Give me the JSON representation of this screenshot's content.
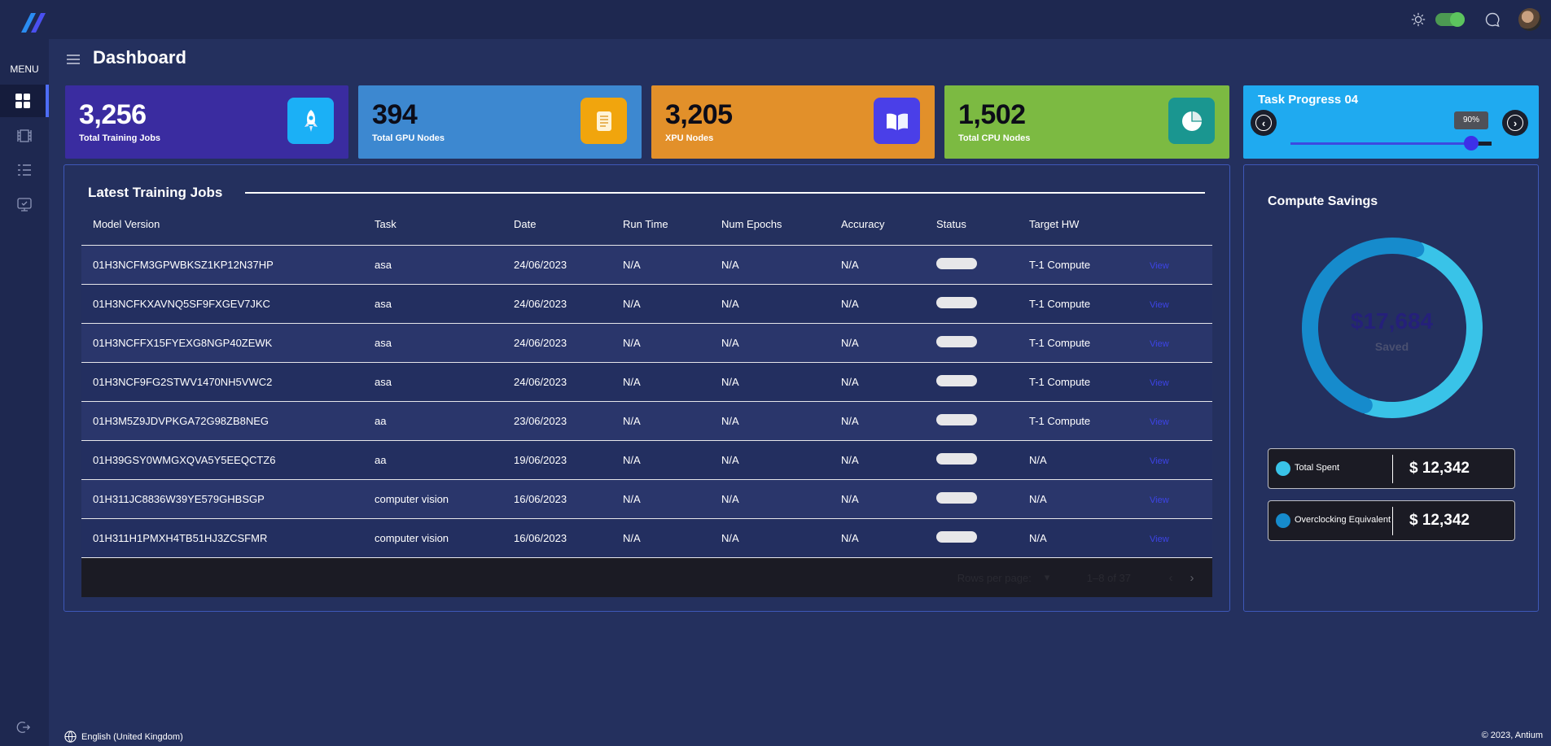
{
  "header": {
    "logo_icon": "brand-slashes-logo",
    "theme_icon": "sun-icon",
    "theme_toggle_on": true,
    "chat_icon": "chat-bubble-icon",
    "avatar_icon": "user-avatar"
  },
  "sidebar": {
    "menu_label": "MENU",
    "items": [
      {
        "icon": "grid-dashboard-icon",
        "active": true
      },
      {
        "icon": "film-strip-icon",
        "active": false
      },
      {
        "icon": "list-icon",
        "active": false
      },
      {
        "icon": "monitor-badge-icon",
        "active": false
      }
    ],
    "logout_icon": "logout-icon"
  },
  "page": {
    "title": "Dashboard"
  },
  "stats": [
    {
      "value": "3,256",
      "label": "Total Training Jobs",
      "icon": "rocket-icon",
      "color": "#3a2ca0",
      "icon_bg": "#1bb0f6"
    },
    {
      "value": "394",
      "label": "Total GPU Nodes",
      "icon": "document-icon",
      "color": "#3d88d0",
      "icon_bg": "#f1a50d"
    },
    {
      "value": "3,205",
      "label": "XPU Nodes",
      "icon": "book-icon",
      "color": "#e2902a",
      "icon_bg": "#4a3fe8"
    },
    {
      "value": "1,502",
      "label": "Total CPU Nodes",
      "icon": "pie-chart-icon",
      "color": "#7cba42",
      "icon_bg": "#1a9690"
    }
  ],
  "task_progress": {
    "title": "Task Progress 04",
    "value": 0.9,
    "value_label": "90%",
    "prev_icon": "chevron-left-icon",
    "next_icon": "chevron-right-icon"
  },
  "jobs": {
    "title": "Latest Training Jobs",
    "columns": [
      "Model Version",
      "Task",
      "Date",
      "Run Time",
      "Num Epochs",
      "Accuracy",
      "Status",
      "Target HW"
    ],
    "rows": [
      {
        "model": "01H3NCFM3GPWBKSZ1KP12N37HP",
        "task": "asa",
        "date": "24/06/2023",
        "runtime": "N/A",
        "epochs": "N/A",
        "accuracy": "N/A",
        "target": "T-1 Compute",
        "action": "View"
      },
      {
        "model": "01H3NCFKXAVNQ5SF9FXGEV7JKC",
        "task": "asa",
        "date": "24/06/2023",
        "runtime": "N/A",
        "epochs": "N/A",
        "accuracy": "N/A",
        "target": "T-1 Compute",
        "action": "View"
      },
      {
        "model": "01H3NCFFX15FYEXG8NGP40ZEWK",
        "task": "asa",
        "date": "24/06/2023",
        "runtime": "N/A",
        "epochs": "N/A",
        "accuracy": "N/A",
        "target": "T-1 Compute",
        "action": "View"
      },
      {
        "model": "01H3NCF9FG2STWV1470NH5VWC2",
        "task": "asa",
        "date": "24/06/2023",
        "runtime": "N/A",
        "epochs": "N/A",
        "accuracy": "N/A",
        "target": "T-1 Compute",
        "action": "View"
      },
      {
        "model": "01H3M5Z9JDVPKGA72G98ZB8NEG",
        "task": "aa",
        "date": "23/06/2023",
        "runtime": "N/A",
        "epochs": "N/A",
        "accuracy": "N/A",
        "target": "T-1 Compute",
        "action": "View"
      },
      {
        "model": "01H39GSY0WMGXQVA5Y5EEQCTZ6",
        "task": "aa",
        "date": "19/06/2023",
        "runtime": "N/A",
        "epochs": "N/A",
        "accuracy": "N/A",
        "target": "N/A",
        "action": "View"
      },
      {
        "model": "01H311JC8836W39YE579GHBSGP",
        "task": "computer vision",
        "date": "16/06/2023",
        "runtime": "N/A",
        "epochs": "N/A",
        "accuracy": "N/A",
        "target": "N/A",
        "action": "View"
      },
      {
        "model": "01H311H1PMXH4TB51HJ3ZCSFMR",
        "task": "computer vision",
        "date": "16/06/2023",
        "runtime": "N/A",
        "epochs": "N/A",
        "accuracy": "N/A",
        "target": "N/A",
        "action": "View"
      }
    ],
    "pagination": {
      "rows_per_page_label": "Rows per page:",
      "range": "1–8 of 37",
      "prev_icon": "chevron-left-icon",
      "next_icon": "chevron-right-icon"
    }
  },
  "savings": {
    "title": "Compute Savings",
    "amount": "$17,684",
    "sub": "Saved",
    "donut": [
      {
        "name": "Total Spent",
        "value": 12342,
        "color": "#39c3e8"
      },
      {
        "name": "Overclocking Equivalent",
        "value": 12342,
        "color": "#168bcc"
      }
    ],
    "legend": [
      {
        "name": "Total Spent",
        "amount": "$ 12,342",
        "color": "#39c3e8"
      },
      {
        "name": "Overclocking Equivalent",
        "amount": "$ 12,342",
        "color": "#168bcc"
      }
    ]
  },
  "footer": {
    "language": "English (United Kingdom)",
    "language_icon": "globe-icon",
    "copyright": "© 2023, Antium"
  }
}
